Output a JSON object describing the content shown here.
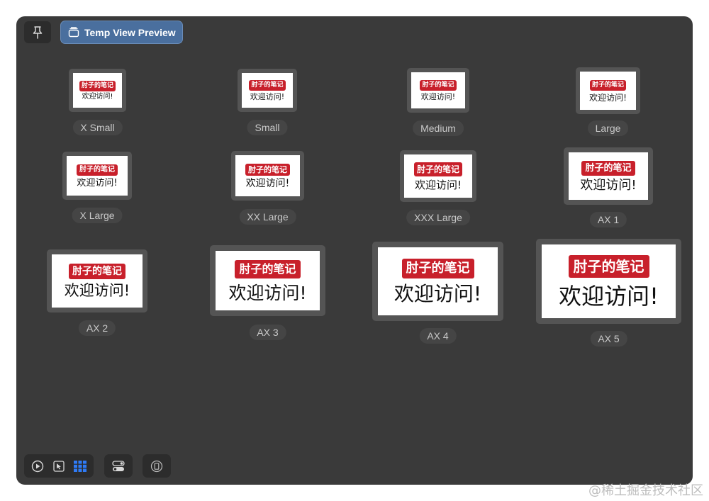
{
  "toolbar": {
    "pin_icon": "pin-icon",
    "preview_label": "Temp View Preview",
    "preview_icon": "stack-icon"
  },
  "preview_content": {
    "logo_text": "肘子的笔记",
    "welcome_text": "欢迎访问!"
  },
  "size_variants": [
    {
      "label": "X Small"
    },
    {
      "label": "Small"
    },
    {
      "label": "Medium"
    },
    {
      "label": "Large"
    },
    {
      "label": "X Large"
    },
    {
      "label": "XX Large"
    },
    {
      "label": "XXX Large"
    },
    {
      "label": "AX 1"
    },
    {
      "label": "AX 2"
    },
    {
      "label": "AX 3"
    },
    {
      "label": "AX 4"
    },
    {
      "label": "AX 5"
    }
  ],
  "bottom_toolbar": {
    "icons": [
      "play-icon",
      "select-cursor-icon",
      "grid-variants-icon",
      "toggle-settings-icon",
      "device-icon"
    ]
  },
  "watermark": "@稀土掘金技术社区",
  "colors": {
    "canvas_bg": "#3a3a3a",
    "accent_button": "#4a6f9e",
    "logo_red": "#c8202b",
    "selected_icon_blue": "#2f7bf6"
  }
}
